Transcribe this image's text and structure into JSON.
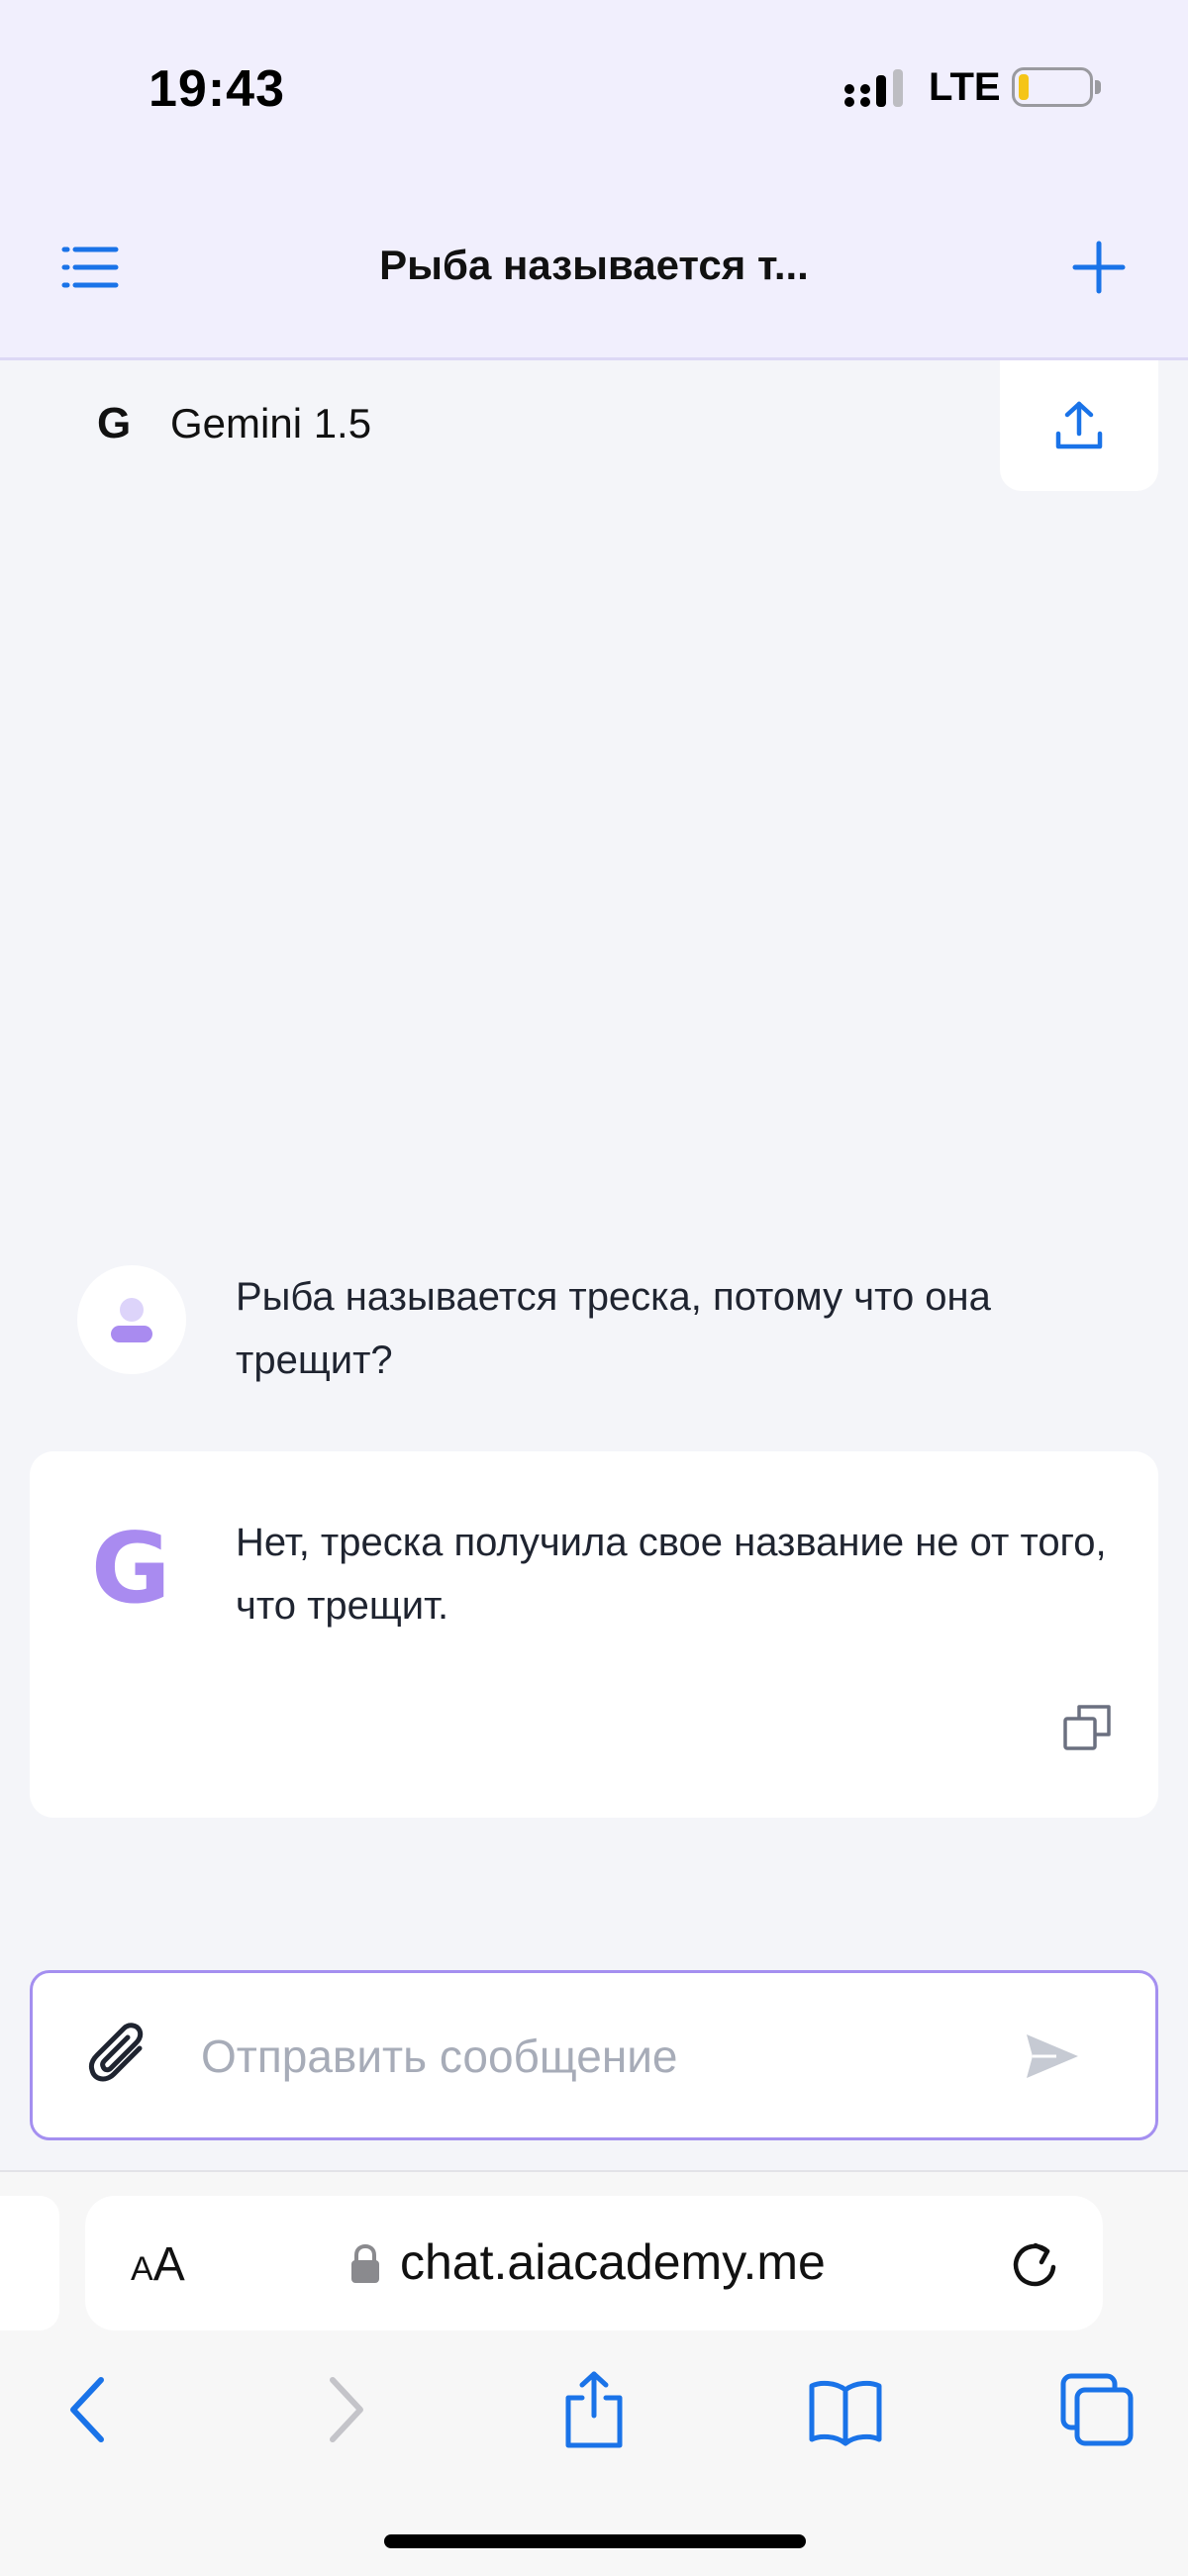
{
  "status_bar": {
    "time": "19:43",
    "network": "LTE"
  },
  "header": {
    "title": "Рыба называется т...",
    "menu_icon": "list-menu-icon",
    "new_chat_icon": "plus-icon",
    "accent": "#1a73e8"
  },
  "model": {
    "logo": "G",
    "name": "Gemini 1.5"
  },
  "messages": [
    {
      "role": "user",
      "text": "Рыба называется треска, потому что она трещит?"
    },
    {
      "role": "assistant",
      "logo": "G",
      "text": "Нет, треска получила свое название не от того, что трещит."
    }
  ],
  "composer": {
    "placeholder": "Отправить сообщение"
  },
  "browser": {
    "text_size_label_small": "A",
    "text_size_label_big": "A",
    "url": "chat.aiacademy.me"
  },
  "colors": {
    "accent": "#1a73e8",
    "bot_logo": "#a98bf0",
    "composer_border": "#a48ff0",
    "battery": "#f5c518"
  }
}
